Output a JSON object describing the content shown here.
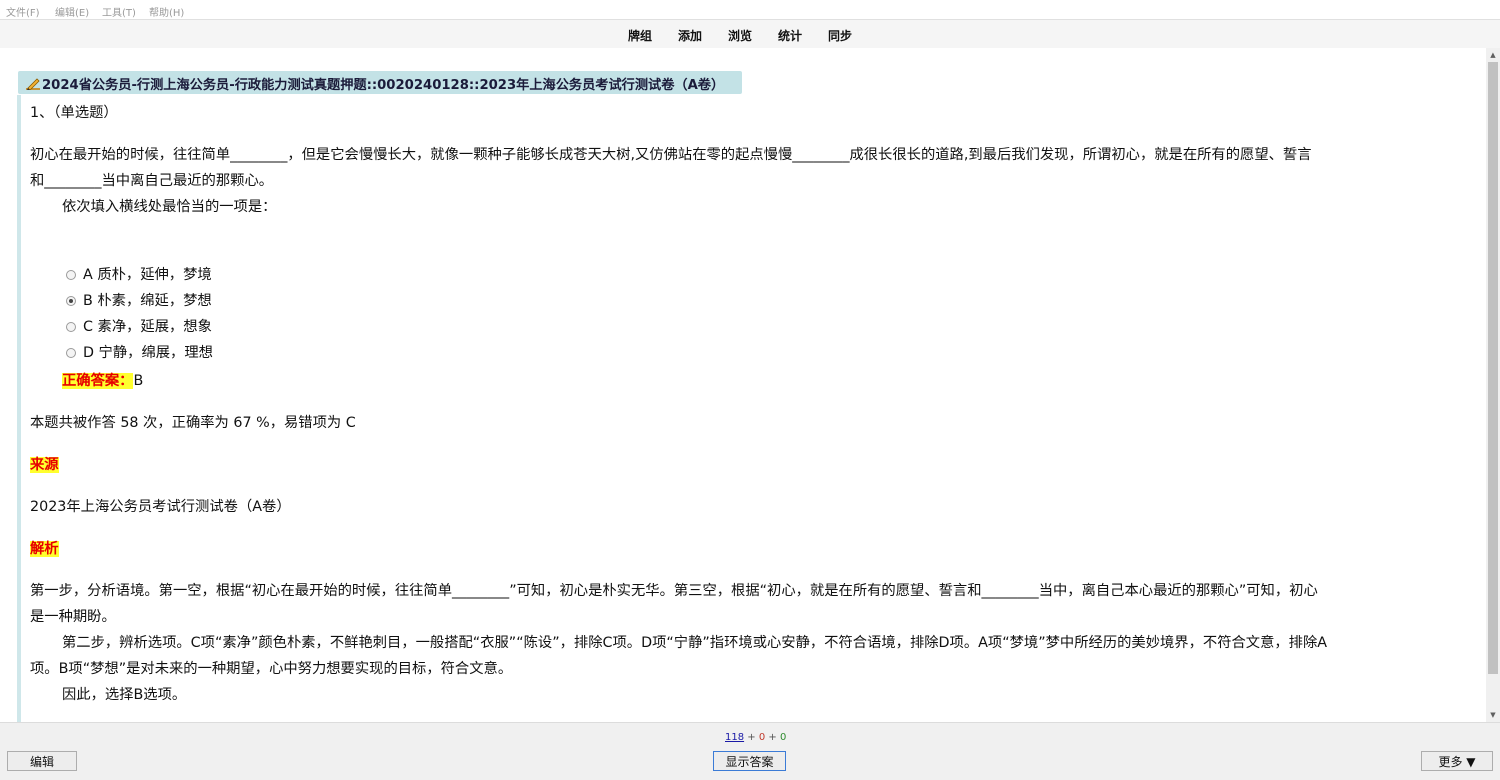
{
  "menu": [
    "文件(F)",
    "编辑(E)",
    "工具(T)",
    "帮助(H)"
  ],
  "toolbar": [
    "牌组",
    "添加",
    "浏览",
    "统计",
    "同步"
  ],
  "card": {
    "deck_title": "2024省公务员-行测上海公务员-行政能力测试真题押题::0020240128::2023年上海公务员考试行测试卷（A卷）",
    "question_type": "1、（单选题）",
    "stem_line1": "初心在最开始的时候，往往简单________，但是它会慢慢长大，就像一颗种子能够长成苍天大树,又仿佛站在零的起点慢慢________成很长很长的道路,到最后我们发现，所谓初心，就是在所有的愿望、誓言",
    "stem_line2": "和________当中离自己最近的那颗心。",
    "prompt": "依次填入横线处最恰当的一项是：",
    "options": [
      {
        "label": "A 质朴，延伸，梦境",
        "selected": false
      },
      {
        "label": "B 朴素，绵延，梦想",
        "selected": true
      },
      {
        "label": "C 素净，延展，想象",
        "selected": false
      },
      {
        "label": "D 宁静，绵展，理想",
        "selected": false
      }
    ],
    "answer_label": "正确答案：",
    "answer_value": "B",
    "stats": "本题共被作答 58 次，正确率为 67 %，易错项为 C",
    "source_label": "来源",
    "source_text": "2023年上海公务员考试行测试卷（A卷）",
    "analysis_label": "解析",
    "analysis_p1_line1": "第一步，分析语境。第一空，根据“初心在最开始的时候，往往简单________”可知，初心是朴实无华。第三空，根据“初心，就是在所有的愿望、誓言和________当中，离自己本心最近的那颗心”可知，初心",
    "analysis_p1_line2": "是一种期盼。",
    "analysis_p2_line1": "第二步，辨析选项。C项“素净”颜色朴素，不鲜艳刺目，一般搭配“衣服”“陈设”，排除C项。D项“宁静”指环境或心安静，不符合语境，排除D项。A项“梦境”梦中所经历的美妙境界，不符合文意，排除A",
    "analysis_p2_line2": "项。B项“梦想”是对未来的一种期望，心中努力想要实现的目标，符合文意。",
    "analysis_p3": "因此，选择B选项。"
  },
  "footer": {
    "edit_label": "编辑",
    "show_answer_label": "显示答案",
    "more_label": "更多 ▼",
    "count_new": "118",
    "count_learn": "0",
    "count_review": "0",
    "plus": "+",
    "colors": {
      "new": "#1a1aa6",
      "learn": "#c0392b",
      "review": "#2e8b2e"
    }
  }
}
